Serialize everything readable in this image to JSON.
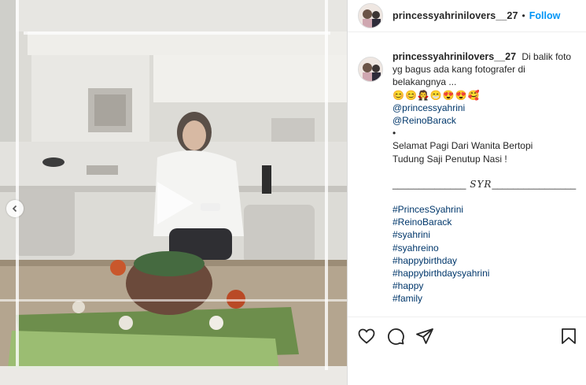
{
  "post": {
    "username": "princessyahrinilovers__27",
    "follow_label": "Follow",
    "separator": "•"
  },
  "caption": {
    "username": "princessyahrinilovers__27",
    "text_line1": "Di balik foto",
    "text_line2": "yg bagus ada kang fotografer di",
    "text_line3": "belakangnya ...",
    "emojis": "😊😊🧛😁😍😍🥰",
    "mention1": "@princessyahrini",
    "mention2": "@ReinoBarack",
    "bullet": "•",
    "greeting_line1": "Selamat Pagi Dari Wanita Bertopi",
    "greeting_line2": "Tudung Saji Penutup Nasi !",
    "sig_left": "______________",
    "sig_text": " SYR",
    "sig_right": "________________",
    "hashtags": [
      "#PrincesSyahrini",
      "#ReinoBarack",
      "#syahrini",
      "#syahreino",
      "#happybirthday",
      "#happybirthdaysyahrini",
      "#happy",
      "#family"
    ]
  },
  "icons": {
    "play": "play-icon",
    "prev": "chevron-left-icon",
    "like": "heart-icon",
    "comment": "comment-icon",
    "share": "send-icon",
    "save": "bookmark-icon"
  },
  "colors": {
    "link": "#00376b",
    "follow": "#0095f6",
    "text": "#262626"
  }
}
